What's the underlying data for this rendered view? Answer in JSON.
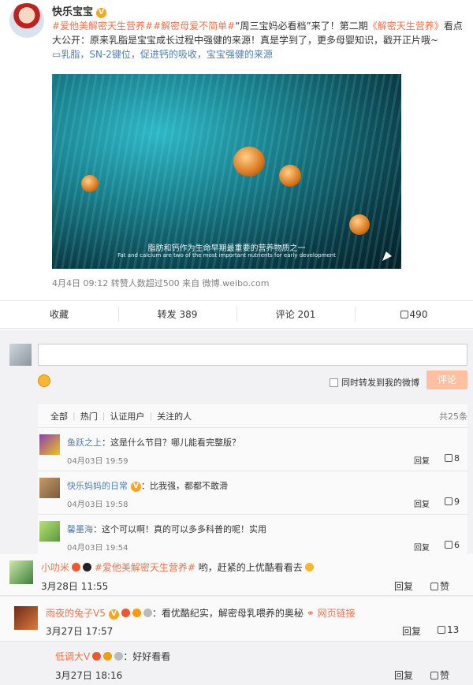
{
  "post": {
    "author": "快乐宝宝",
    "text_topic1": "#爱他美解密天生营养#",
    "text_topic2": "#解密母爱不简单#",
    "text_mid": "“周三宝妈必看档”来了！第二期",
    "text_link": "《解密天生营养》",
    "text_rest": "看点大公开：原来乳脂是宝宝成长过程中强健的来源！真是学到了，更多母婴知识，戳开正片哦~",
    "text_blue": "乳脂，SN-2键位，促进钙的吸收，宝宝强健的来源",
    "video_subtitle_cn": "脂肪和钙作为生命早期最重要的营养物质之一",
    "video_subtitle_en": "Fat and calcium are two of the most important nutrients for early development",
    "meta": "4月4日 09:12 转赞人数超过500 来自 微博.weibo.com"
  },
  "actions": [
    {
      "label": "收藏"
    },
    {
      "label": "转发 389"
    },
    {
      "label": "评论 201"
    },
    {
      "label": "490"
    }
  ],
  "composer": {
    "placeholder": "",
    "forward_label": "同时转发到我的微博",
    "submit_label": "评论"
  },
  "filters": {
    "items": [
      "全部",
      "热门",
      "认证用户",
      "关注的人"
    ],
    "total": "共25条"
  },
  "comments": [
    {
      "name": "鱼跃之上",
      "text": "：这是什么节目？哪儿能看完整版？",
      "time": "04月03日 19:59",
      "reply": "回复",
      "likes": "8"
    },
    {
      "name": "快乐妈妈的日常",
      "text": "：比我强，都都不敢滑",
      "time": "04月03日 19:58",
      "reply": "回复",
      "likes": "9"
    },
    {
      "name": "馨墨海",
      "text": "：这个可以啊！真的可以多多科普的呢！实用",
      "time": "04月03日 19:54",
      "reply": "回复",
      "likes": "6"
    }
  ],
  "big_comments": [
    {
      "name": "小叻米",
      "topic": "#爱他美解密天生营养#",
      "text": " 哟，赶紧的上优酷看看去",
      "time": "3月28日 11:55",
      "reply": "回复",
      "likes": "赞"
    },
    {
      "name": "雨夜的兔子V5",
      "text": "：看优酷纪实，解密母乳喂养的奥秘",
      "link": "网页链接",
      "time": "3月27日 17:57",
      "reply": "回复",
      "likes": "13"
    },
    {
      "name": "低调大V",
      "text": "：好好看看",
      "time": "3月27日 18:16",
      "reply": "回复",
      "likes": "赞"
    }
  ]
}
